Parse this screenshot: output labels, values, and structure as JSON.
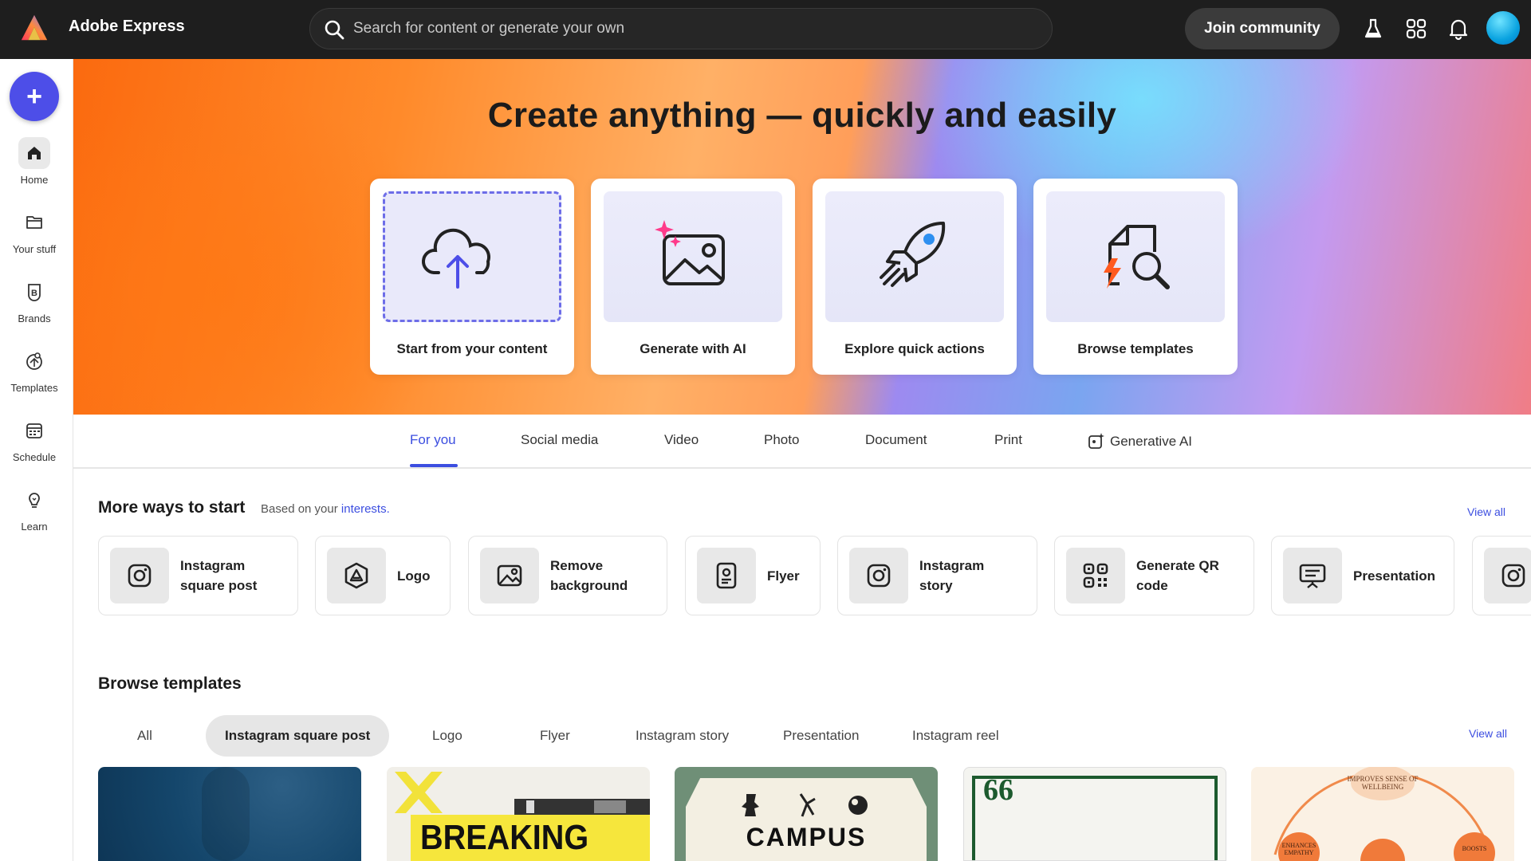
{
  "app": {
    "title": "Adobe Express"
  },
  "search": {
    "placeholder": "Search for content or generate your own"
  },
  "header": {
    "join_label": "Join community",
    "icons": [
      "flask-icon",
      "apps-grid-icon",
      "bell-icon",
      "avatar"
    ]
  },
  "create_button": {
    "label": "+"
  },
  "rail": {
    "items": [
      {
        "label": "Home",
        "icon": "home-icon",
        "active": true
      },
      {
        "label": "Your stuff",
        "icon": "folder-icon"
      },
      {
        "label": "Brands",
        "icon": "brand-icon"
      },
      {
        "label": "Templates",
        "icon": "templates-icon"
      },
      {
        "label": "Schedule",
        "icon": "calendar-icon"
      },
      {
        "label": "Learn",
        "icon": "lightbulb-icon"
      }
    ]
  },
  "hero": {
    "title": "Create anything — quickly and easily",
    "cards": [
      {
        "label": "Start from your content",
        "icon": "cloud-upload-icon"
      },
      {
        "label": "Generate with AI",
        "icon": "image-sparkle-icon"
      },
      {
        "label": "Explore quick actions",
        "icon": "rocket-icon"
      },
      {
        "label": "Browse templates",
        "icon": "template-search-icon"
      }
    ]
  },
  "tabs": {
    "items": [
      "For you",
      "Social media",
      "Video",
      "Photo",
      "Document",
      "Print",
      "Generative AI"
    ],
    "active": "For you"
  },
  "more_ways": {
    "title": "More ways to start",
    "subtitle_prefix": "Based on your",
    "subtitle_link": "interests.",
    "view_all": "View all",
    "items": [
      {
        "label_1": "Instagram",
        "label_2": "square post",
        "icon": "instagram-icon"
      },
      {
        "label_1": "Logo",
        "label_2": "",
        "icon": "logo-icon"
      },
      {
        "label_1": "Remove",
        "label_2": "background",
        "icon": "remove-background-icon"
      },
      {
        "label_1": "Flyer",
        "label_2": "",
        "icon": "flyer-icon"
      },
      {
        "label_1": "Instagram",
        "label_2": "story",
        "icon": "instagram-icon"
      },
      {
        "label_1": "Generate QR",
        "label_2": "code",
        "icon": "qr-code-icon"
      },
      {
        "label_1": "Presentation",
        "label_2": "",
        "icon": "presentation-icon"
      }
    ]
  },
  "browse": {
    "title": "Browse templates",
    "view_all": "View all",
    "chips": [
      "All",
      "Instagram square post",
      "Logo",
      "Flyer",
      "Instagram story",
      "Presentation",
      "Instagram reel"
    ],
    "active_chip": "Instagram square post",
    "templates": [
      {
        "text": ""
      },
      {
        "text": "BREAKING NEWS"
      },
      {
        "text": "CAMPUS"
      },
      {
        "text": "66"
      },
      {
        "text_top": "IMPROVES SENSE OF WELLBEING",
        "text_left": "ENHANCES EMPATHY",
        "text_right": "BOOSTS"
      }
    ]
  },
  "colors": {
    "accent": "#3c4ee0",
    "topbar": "#1e1e1e",
    "create": "#4d4ee8"
  }
}
